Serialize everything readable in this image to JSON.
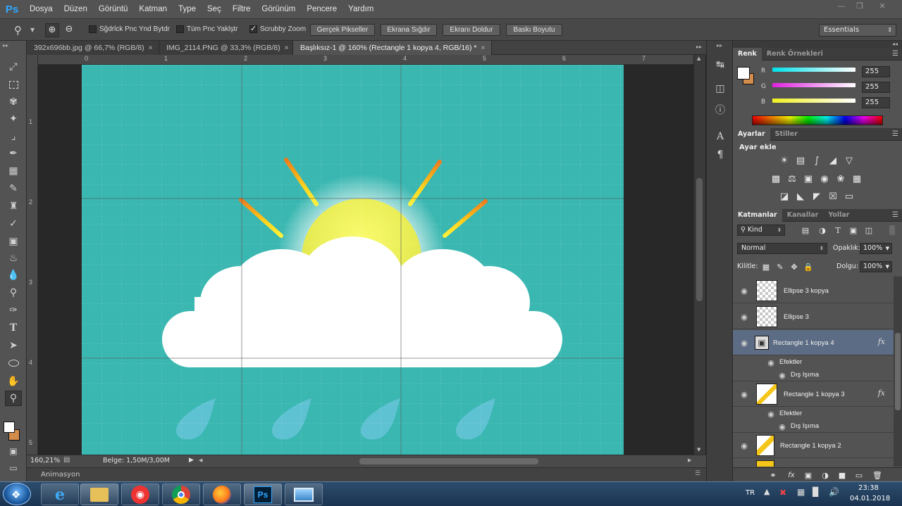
{
  "app": {
    "logo": "Ps"
  },
  "menu": [
    "Dosya",
    "Düzen",
    "Görüntü",
    "Katman",
    "Type",
    "Seç",
    "Filtre",
    "Görünüm",
    "Pencere",
    "Yardım"
  ],
  "options": {
    "resize_windows": "Sğdrlck Pnc Ynd Bytdr",
    "zoom_all": "Tüm Pnc Yaklştr",
    "scrubby": "Scrubby Zoom",
    "btn_actual": "Gerçek Pikseller",
    "btn_fit": "Ekrana Sığdır",
    "btn_fill": "Ekranı Doldur",
    "btn_print": "Baskı Boyutu",
    "workspace": "Essentials"
  },
  "tabs": [
    {
      "label": "392x696bb.jpg @ 66,7% (RGB/8)",
      "close": "×"
    },
    {
      "label": "IMG_2114.PNG @ 33,3% (RGB/8)",
      "close": "×"
    },
    {
      "label": "Başlıksız-1 @ 160% (Rectangle 1 kopya 4, RGB/16) *",
      "close": "×"
    }
  ],
  "ruler_top": [
    "0",
    "1",
    "2",
    "3",
    "4",
    "5",
    "6",
    "7"
  ],
  "ruler_left": [
    "1",
    "2",
    "3",
    "4",
    "5"
  ],
  "status": {
    "zoom": "160,21%",
    "doc": "Belge: 1,50M/3,00M"
  },
  "animation_label": "Animasyon",
  "color_panel": {
    "tabs": [
      "Renk",
      "Renk Örnekleri"
    ],
    "channels": [
      {
        "label": "R",
        "value": "255",
        "color": "#35d6e0"
      },
      {
        "label": "G",
        "value": "255",
        "color": "#e040e0"
      },
      {
        "label": "B",
        "value": "255",
        "color": "#f0f040"
      }
    ]
  },
  "adjust_panel": {
    "tabs": [
      "Ayarlar",
      "Stiller"
    ],
    "heading": "Ayar ekle"
  },
  "layers_panel": {
    "tabs": [
      "Katmanlar",
      "Kanallar",
      "Yollar"
    ],
    "filter": "Kind",
    "blend": "Normal",
    "opacity_label": "Opaklık:",
    "opacity": "100%",
    "lock_label": "Kilitle:",
    "fill_label": "Dolgu:",
    "fill": "100%",
    "layers": [
      {
        "name": "Ellipse 3 kopya"
      },
      {
        "name": "Ellipse 3"
      },
      {
        "name": "Rectangle 1 kopya 4",
        "fx": "fx",
        "selected": true
      },
      {
        "name": "Efektler"
      },
      {
        "name": "Dış Işıma"
      },
      {
        "name": "Rectangle 1 kopya 3",
        "fx": "fx"
      },
      {
        "name": "Efektler"
      },
      {
        "name": "Dış Işıma"
      },
      {
        "name": "Rectangle 1 kopya 2"
      }
    ]
  },
  "taskbar": {
    "lang": "TR",
    "time": "23:38",
    "date": "04.01.2018",
    "ps_label": "Ps"
  }
}
